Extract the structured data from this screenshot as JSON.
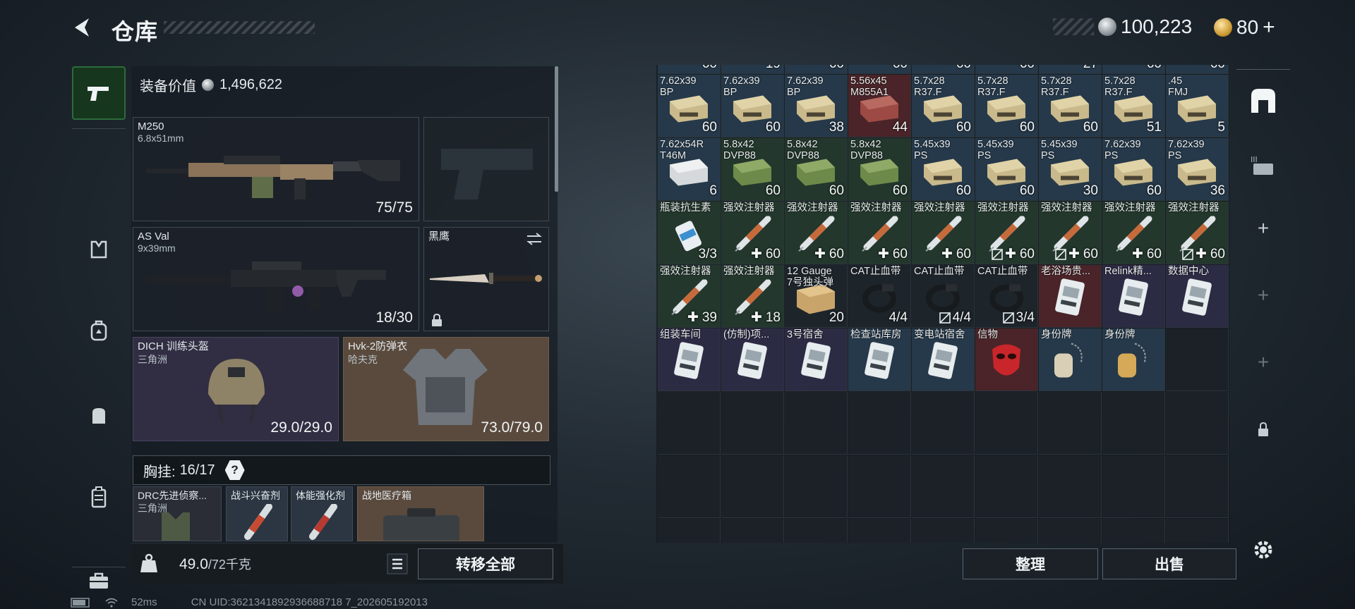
{
  "header": {
    "title": "仓库"
  },
  "currency": {
    "silver": "100,223",
    "gold": "80",
    "gold_plus": "+"
  },
  "loadout": {
    "value_label": "装备价值",
    "value": "1,496,622",
    "primary": {
      "name": "M250",
      "caliber": "6.8x51mm",
      "ammo": "75/75"
    },
    "secondary": {
      "name": "AS Val",
      "caliber": "9x39mm",
      "ammo": "18/30"
    },
    "melee": {
      "name": "黑鹰"
    },
    "helmet": {
      "name": "DICH 训练头盔",
      "faction": "三角洲",
      "durability": "29.0/29.0"
    },
    "armor": {
      "name": "Hvk-2防弹衣",
      "faction": "哈夫克",
      "durability": "73.0/79.0"
    },
    "chest_rig": {
      "label": "胸挂:",
      "capacity": "16/17",
      "help": "?"
    },
    "rig_items": [
      {
        "name": "DRC先进侦察...",
        "sub": "三角洲"
      },
      {
        "name": "战斗兴奋剂"
      },
      {
        "name": "体能强化剂"
      },
      {
        "name": "战地医疗箱"
      }
    ]
  },
  "weight": {
    "current": "49.0",
    "max": "/72千克"
  },
  "actions": {
    "transfer_all": "转移全部",
    "sort": "整理",
    "sell": "出售"
  },
  "top_partial_counts": [
    "60",
    "19",
    "60",
    "60",
    "60",
    "60",
    "27",
    "60",
    "60"
  ],
  "grid": [
    [
      {
        "label": "7.62x39\nBP",
        "count": "60",
        "q": "blue",
        "art": "ammo"
      },
      {
        "label": "7.62x39\nBP",
        "count": "60",
        "q": "blue",
        "art": "ammo"
      },
      {
        "label": "7.62x39\nBP",
        "count": "38",
        "q": "blue",
        "art": "ammo"
      },
      {
        "label": "5.56x45\nM855A1",
        "count": "44",
        "q": "red",
        "art": "ammo-red"
      },
      {
        "label": "5.7x28\nR37.F",
        "count": "60",
        "q": "blue",
        "art": "ammo"
      },
      {
        "label": "5.7x28\nR37.F",
        "count": "60",
        "q": "blue",
        "art": "ammo"
      },
      {
        "label": "5.7x28\nR37.F",
        "count": "60",
        "q": "blue",
        "art": "ammo"
      },
      {
        "label": "5.7x28\nR37.F",
        "count": "51",
        "q": "blue",
        "art": "ammo"
      },
      {
        "label": ".45\nFMJ",
        "count": "5",
        "q": "blue",
        "art": "ammo"
      }
    ],
    [
      {
        "label": "7.62x54R\nT46M",
        "count": "6",
        "q": "blue",
        "art": "ammo-white"
      },
      {
        "label": "5.8x42\nDVP88",
        "count": "60",
        "q": "green",
        "art": "ammo-green"
      },
      {
        "label": "5.8x42\nDVP88",
        "count": "60",
        "q": "green",
        "art": "ammo-green"
      },
      {
        "label": "5.8x42\nDVP88",
        "count": "60",
        "q": "green",
        "art": "ammo-green"
      },
      {
        "label": "5.45x39\nPS",
        "count": "60",
        "q": "blue",
        "art": "ammo"
      },
      {
        "label": "5.45x39\nPS",
        "count": "60",
        "q": "blue",
        "art": "ammo"
      },
      {
        "label": "5.45x39\nPS",
        "count": "30",
        "q": "blue",
        "art": "ammo"
      },
      {
        "label": "7.62x39\nPS",
        "count": "60",
        "q": "blue",
        "art": "ammo"
      },
      {
        "label": "7.62x39\nPS",
        "count": "36",
        "q": "blue",
        "art": "ammo"
      }
    ],
    [
      {
        "label": "瓶装抗生素",
        "count": "3/3",
        "q": "green",
        "art": "bottle"
      },
      {
        "label": "强效注射器",
        "count": "60",
        "plus": true,
        "q": "green",
        "art": "syringe"
      },
      {
        "label": "强效注射器",
        "count": "60",
        "plus": true,
        "q": "green",
        "art": "syringe"
      },
      {
        "label": "强效注射器",
        "count": "60",
        "plus": true,
        "q": "green",
        "art": "syringe"
      },
      {
        "label": "强效注射器",
        "count": "60",
        "plus": true,
        "q": "green",
        "art": "syringe"
      },
      {
        "label": "强效注射器",
        "count": "60",
        "plus": true,
        "noresale": true,
        "q": "green",
        "art": "syringe"
      },
      {
        "label": "强效注射器",
        "count": "60",
        "plus": true,
        "noresale": true,
        "q": "green",
        "art": "syringe"
      },
      {
        "label": "强效注射器",
        "count": "60",
        "plus": true,
        "q": "green",
        "art": "syringe"
      },
      {
        "label": "强效注射器",
        "count": "60",
        "plus": true,
        "noresale": true,
        "q": "green",
        "art": "syringe"
      }
    ],
    [
      {
        "label": "强效注射器",
        "count": "39",
        "plus": true,
        "q": "green",
        "art": "syringe"
      },
      {
        "label": "强效注射器",
        "count": "18",
        "plus": true,
        "q": "green",
        "art": "syringe"
      },
      {
        "label": "12 Gauge\n7号独头弹",
        "count": "20",
        "q": "dark",
        "art": "box"
      },
      {
        "label": "CAT止血带",
        "count": "4/4",
        "q": "dark",
        "art": "tourniquet"
      },
      {
        "label": "CAT止血带",
        "count": "4/4",
        "noresale": true,
        "q": "dark",
        "art": "tourniquet"
      },
      {
        "label": "CAT止血带",
        "count": "3/4",
        "noresale": true,
        "q": "dark",
        "art": "tourniquet"
      },
      {
        "label": "老浴场贵...",
        "count": "",
        "q": "red",
        "art": "card"
      },
      {
        "label": "Relink精...",
        "count": "",
        "q": "purple",
        "art": "card"
      },
      {
        "label": "数据中心",
        "count": "",
        "q": "purple",
        "art": "card"
      }
    ],
    [
      {
        "label": "组装车间",
        "count": "",
        "q": "purple",
        "art": "card"
      },
      {
        "label": "(仿制)项...",
        "count": "",
        "q": "purple",
        "art": "card"
      },
      {
        "label": "3号宿舍",
        "count": "",
        "q": "purple",
        "art": "card"
      },
      {
        "label": "检查站库房",
        "count": "",
        "q": "blue",
        "art": "card"
      },
      {
        "label": "变电站宿舍",
        "count": "",
        "q": "blue",
        "art": "card"
      },
      {
        "label": "信物",
        "count": "",
        "q": "red",
        "art": "mask"
      },
      {
        "label": "身份牌",
        "count": "",
        "q": "blue",
        "art": "tag"
      },
      {
        "label": "身份牌",
        "count": "",
        "q": "blue",
        "art": "tag-gold"
      },
      {
        "label": "",
        "count": "",
        "q": "empty",
        "art": ""
      }
    ]
  ],
  "status": {
    "ping": "52ms",
    "uid": "CN UID:3621341892936688718 7_202605192013"
  }
}
